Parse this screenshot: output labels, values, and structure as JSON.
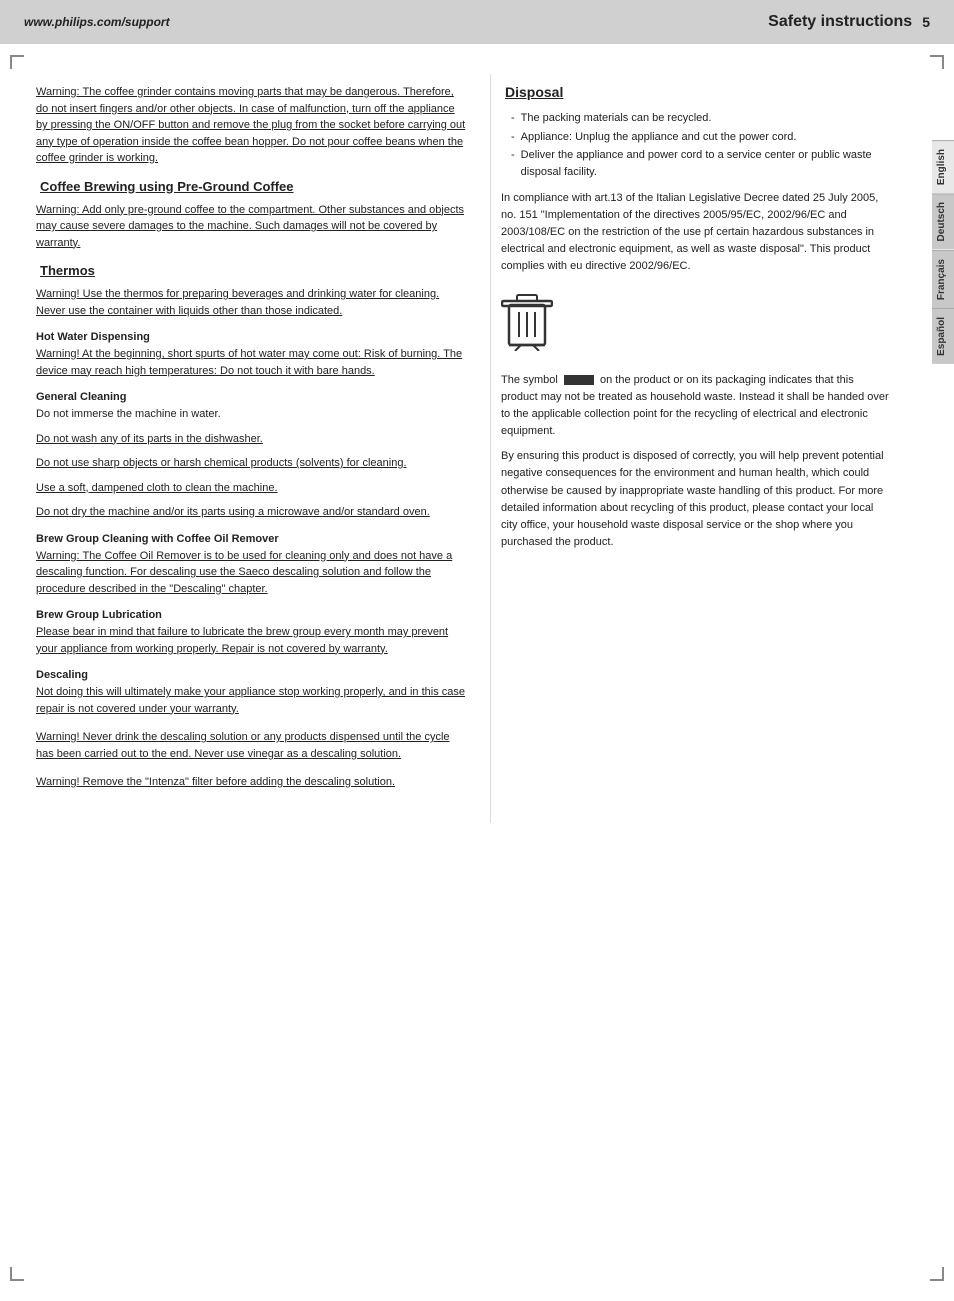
{
  "header": {
    "url": "www.philips.com/support",
    "title": "Safety instructions",
    "page_number": "5"
  },
  "lang_tabs": [
    {
      "label": "English",
      "active": true
    },
    {
      "label": "Deutsch",
      "active": false
    },
    {
      "label": "Français",
      "active": false
    },
    {
      "label": "Español",
      "active": false
    }
  ],
  "left_col": {
    "warning_intro": "Warning: The coffee grinder contains moving parts that may be dangerous. Therefore, do not insert fingers and/or other objects. In case of malfunction, turn off the appliance by pressing the ON/OFF button and remove the plug from the socket before carrying out any type of operation inside the coffee bean hopper. Do not pour coffee beans when the coffee grinder is working.",
    "sections": [
      {
        "heading": "Coffee Brewing using Pre-Ground Coffee",
        "heading_underline": true,
        "content": "Warning: Add only pre-ground coffee to the compartment. Other substances and objects may cause severe damages to the machine. Such damages will not be covered by warranty."
      },
      {
        "heading": "Thermos",
        "heading_underline": true,
        "content": "Warning! Use the thermos for preparing beverages and drinking water for cleaning. Never use the container with liquids other than those indicated."
      },
      {
        "subheading": "Hot Water Dispensing",
        "content": "Warning! At the beginning, short spurts of hot water may come out: Risk of burning. The device may reach high temperatures: Do not touch it with bare hands."
      },
      {
        "subheading": "General Cleaning",
        "lines": [
          "Do not immerse the machine in water.",
          "Do not wash any of its parts in the dishwasher.",
          "Do not use sharp objects or harsh chemical products (solvents) for cleaning.",
          "Use a soft, dampened cloth to clean the machine.",
          "Do not dry the machine and/or its parts using a microwave and/or standard oven."
        ]
      },
      {
        "subheading": "Brew Group Cleaning with Coffee Oil Remover",
        "content": "Warning: The Coffee Oil Remover is to be used for cleaning only and does not have a descaling function. For descaling use the Saeco descaling solution and follow the procedure described in the \"Descaling\" chapter."
      },
      {
        "subheading": "Brew Group Lubrication",
        "content": "Please bear in mind that failure to lubricate the brew group every month may prevent your appliance from working properly. Repair is not covered by warranty."
      },
      {
        "subheading": "Descaling",
        "lines": [
          "Not doing this will ultimately make your appliance stop working properly, and in this case repair is not covered under your warranty."
        ]
      },
      {
        "content": "Warning! Never drink the descaling solution or any products dispensed until the cycle has been carried out to the end. Never use vinegar as a descaling solution."
      },
      {
        "content": "Warning! Remove the \"Intenza\" filter before adding the descaling solution."
      }
    ]
  },
  "right_col": {
    "disposal_heading": "Disposal",
    "bullet_items": [
      "The packing materials can be recycled.",
      "Appliance: Unplug the appliance and cut the power cord.",
      "Deliver the appliance and power cord to a service center or public waste disposal facility."
    ],
    "compliance_text": "In compliance with art.13 of the Italian Legislative Decree dated 25 July 2005, no. 151 \"Implementation of the directives 2005/95/EC, 2002/96/EC and 2003/108/EC on the restriction of the use pf certain hazardous substances in electrical and electronic equipment, as well as waste disposal\". This product complies with eu directive 2002/96/EC.",
    "symbol_text": "The symbol        on the product or on its packaging indicates that this product may not be treated as household waste. Instead it shall be handed over to the applicable collection point for the recycling of electrical and electronic equipment.",
    "recycling_text": "By ensuring this product is disposed of correctly, you will help prevent potential negative consequences for the environment and human health, which could otherwise be caused by inappropriate waste handling of this product. For more detailed information about recycling of this product, please contact your local city office, your household waste disposal service or the shop where you purchased the product."
  }
}
